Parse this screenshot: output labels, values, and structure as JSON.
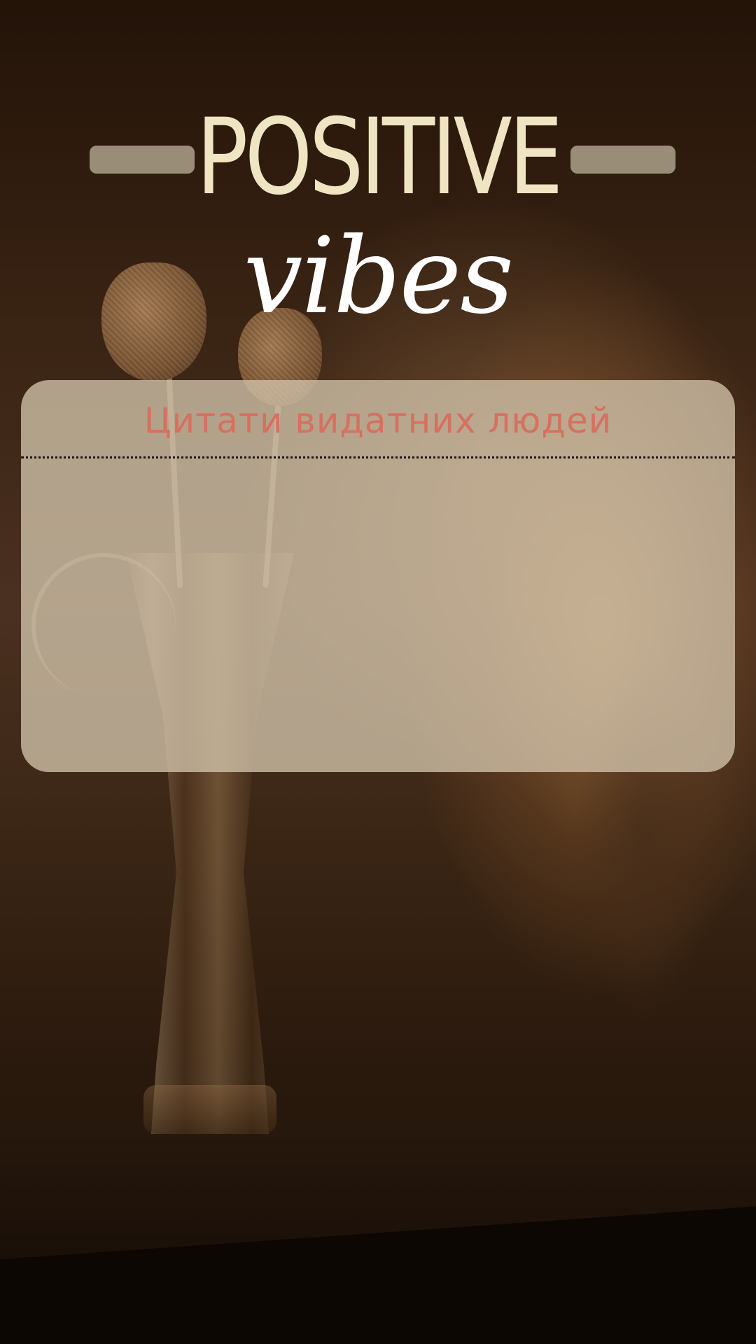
{
  "poster": {
    "title_main": "POSITIVE",
    "title_script": "vibes",
    "colors": {
      "title_main": "#efe5c2",
      "title_script": "#ffffff",
      "dash": "#9a8d78",
      "card_bg": "#d0c0a8",
      "card_heading": "#d6705f"
    }
  },
  "card": {
    "heading": "Цитати видатних людей"
  }
}
